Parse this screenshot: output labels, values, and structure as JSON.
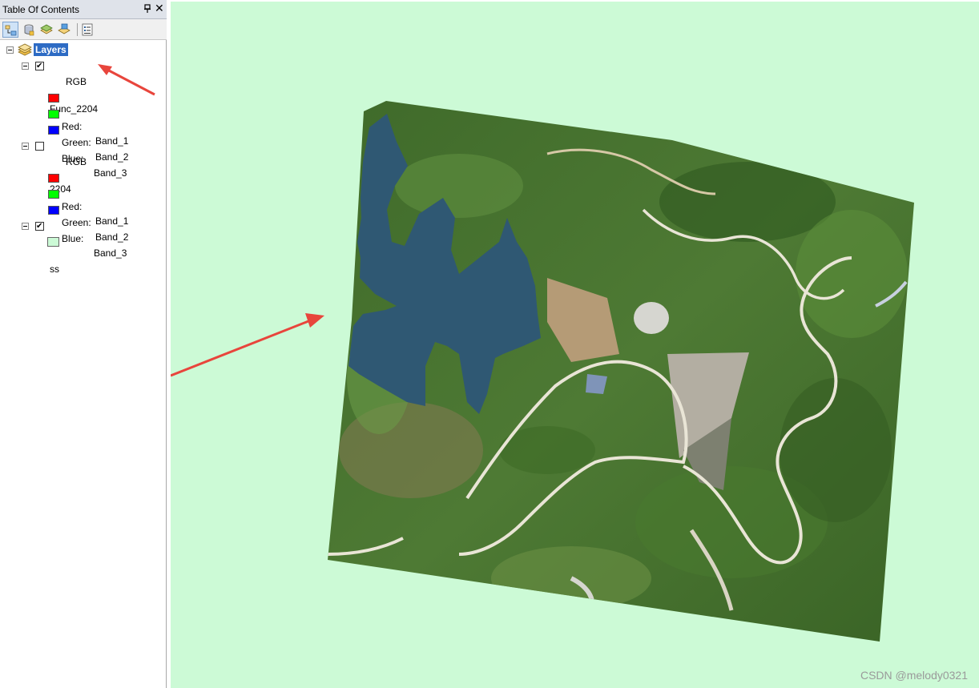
{
  "toc": {
    "title": "Table Of Contents",
    "root_label": "Layers",
    "layers": [
      {
        "name": "Func_2204",
        "checked": true,
        "renderer": "RGB",
        "bands": [
          {
            "channel": "Red:",
            "band": "Band_1",
            "color": "#ff0000"
          },
          {
            "channel": "Green:",
            "band": "Band_2",
            "color": "#00ff00"
          },
          {
            "channel": "Blue:",
            "band": "Band_3",
            "color": "#0000ff"
          }
        ]
      },
      {
        "name": "2204",
        "checked": false,
        "renderer": "RGB",
        "bands": [
          {
            "channel": "Red:",
            "band": "Band_1",
            "color": "#ff0000"
          },
          {
            "channel": "Green:",
            "band": "Band_2",
            "color": "#00ff00"
          },
          {
            "channel": "Blue:",
            "band": "Band_3",
            "color": "#0000ff"
          }
        ]
      },
      {
        "name": "ss",
        "checked": true,
        "fill": "#ccfad6"
      }
    ],
    "toolbar_icons": [
      "list-by-drawing-order-icon",
      "list-by-source-icon",
      "list-by-visibility-icon",
      "list-by-selection-icon",
      "options-icon"
    ]
  },
  "map": {
    "background": "#ccfad6",
    "water_color": "#2f5873",
    "annotation_color": "#e8453c"
  },
  "watermark": "CSDN @melody0321"
}
